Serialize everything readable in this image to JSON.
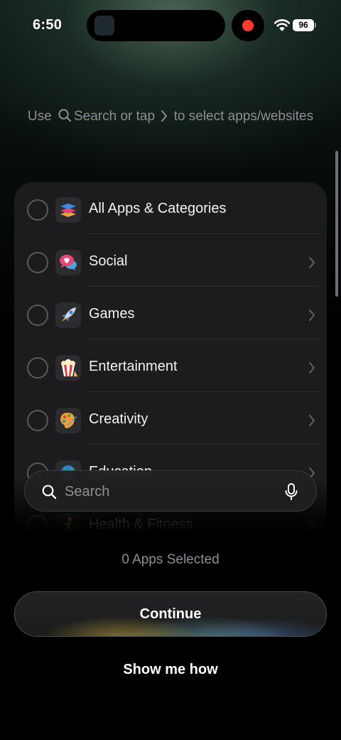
{
  "status_bar": {
    "time": "6:50",
    "battery": "96",
    "recording_color": "#ff3b30"
  },
  "hint": {
    "prefix": "Use",
    "search_word": "Search",
    "middle": "or tap",
    "suffix": "to select apps/websites",
    "icons": [
      "search-icon",
      "chevron-right-icon"
    ]
  },
  "categories": [
    {
      "label": "All Apps & Categories",
      "icon": "stack-icon",
      "has_chevron": false,
      "selected": false
    },
    {
      "label": "Social",
      "icon": "chat-heart-icon",
      "has_chevron": true,
      "selected": false
    },
    {
      "label": "Games",
      "icon": "rocket-icon",
      "has_chevron": true,
      "selected": false
    },
    {
      "label": "Entertainment",
      "icon": "popcorn-icon",
      "has_chevron": true,
      "selected": false
    },
    {
      "label": "Creativity",
      "icon": "palette-icon",
      "has_chevron": true,
      "selected": false
    },
    {
      "label": "Education",
      "icon": "globe-icon",
      "has_chevron": true,
      "selected": false
    },
    {
      "label": "Health & Fitness",
      "icon": "runner-icon",
      "has_chevron": true,
      "selected": false
    }
  ],
  "search": {
    "placeholder": "Search",
    "value": ""
  },
  "footer": {
    "selected_count": "0 Apps Selected",
    "continue_label": "Continue",
    "show_me_how": "Show me how"
  },
  "colors": {
    "background": "#000000",
    "card": "#1c1c1e",
    "secondary_text": "#8e8e93"
  }
}
